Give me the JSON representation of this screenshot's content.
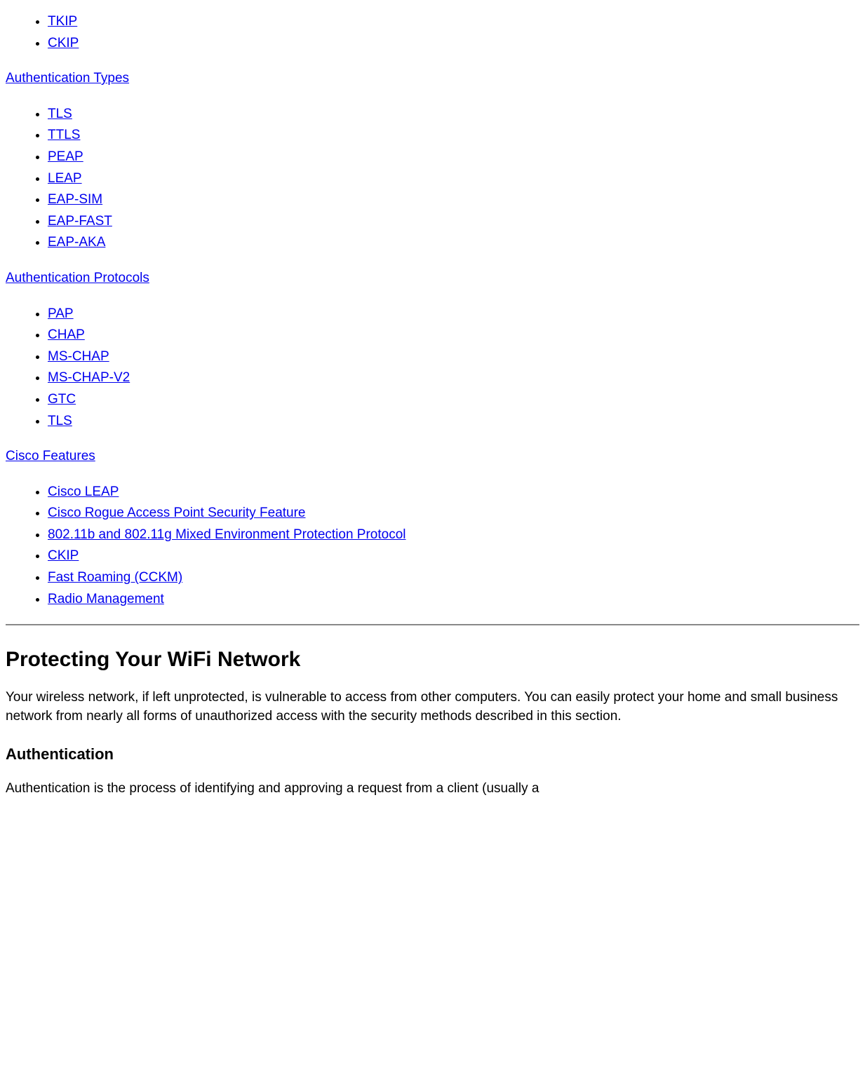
{
  "list1": {
    "items": [
      {
        "label": "TKIP"
      },
      {
        "label": "CKIP"
      }
    ]
  },
  "section_auth_types": {
    "title": "Authentication Types",
    "items": [
      {
        "label": "TLS"
      },
      {
        "label": "TTLS"
      },
      {
        "label": "PEAP"
      },
      {
        "label": "LEAP"
      },
      {
        "label": "EAP-SIM"
      },
      {
        "label": "EAP-FAST"
      },
      {
        "label": "EAP-AKA"
      }
    ]
  },
  "section_auth_protocols": {
    "title": "Authentication Protocols",
    "items": [
      {
        "label": "PAP"
      },
      {
        "label": "CHAP"
      },
      {
        "label": "MS-CHAP"
      },
      {
        "label": "MS-CHAP-V2"
      },
      {
        "label": "GTC"
      },
      {
        "label": "TLS"
      }
    ]
  },
  "section_cisco": {
    "title": "Cisco Features",
    "items": [
      {
        "label": "Cisco LEAP"
      },
      {
        "label": "Cisco Rogue Access Point Security Feature"
      },
      {
        "label": "802.11b and 802.11g Mixed Environment Protection Protocol"
      },
      {
        "label": "CKIP"
      },
      {
        "label": "Fast Roaming (CCKM)"
      },
      {
        "label": "Radio Management"
      }
    ]
  },
  "heading_protecting": "Protecting Your WiFi Network",
  "para_protecting": "Your wireless network, if left unprotected, is vulnerable to access from other computers. You can easily protect your home and small business network from nearly all forms of unauthorized access with the security methods described in this section.",
  "heading_authentication": "Authentication",
  "para_authentication": "Authentication is the process of identifying and approving a request from a client (usually a"
}
